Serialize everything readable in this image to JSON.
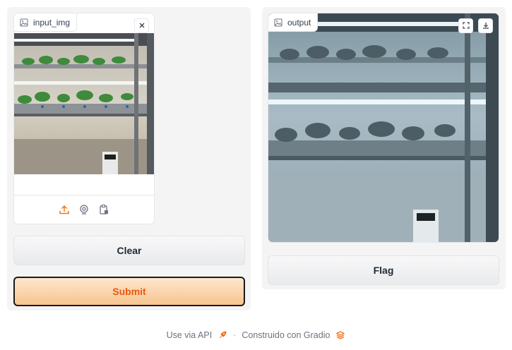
{
  "input": {
    "label": "input_img",
    "label_icon": "image-icon",
    "clear_icon": "close-icon",
    "sources": [
      {
        "name": "upload-icon",
        "color": "#f97316"
      },
      {
        "name": "webcam-icon",
        "color": "#6b7280"
      },
      {
        "name": "clipboard-icon",
        "color": "#6b7280"
      }
    ]
  },
  "output": {
    "label": "output",
    "label_icon": "image-icon",
    "fullscreen_icon": "fullscreen-icon",
    "download_icon": "download-icon"
  },
  "buttons": {
    "clear_label": "Clear",
    "submit_label": "Submit",
    "flag_label": "Flag"
  },
  "footer": {
    "api_text": "Use via API",
    "separator": "·",
    "built_with": "Construido con Gradio"
  },
  "colors": {
    "accent": "#f97316",
    "submit_text": "#ea580c"
  }
}
